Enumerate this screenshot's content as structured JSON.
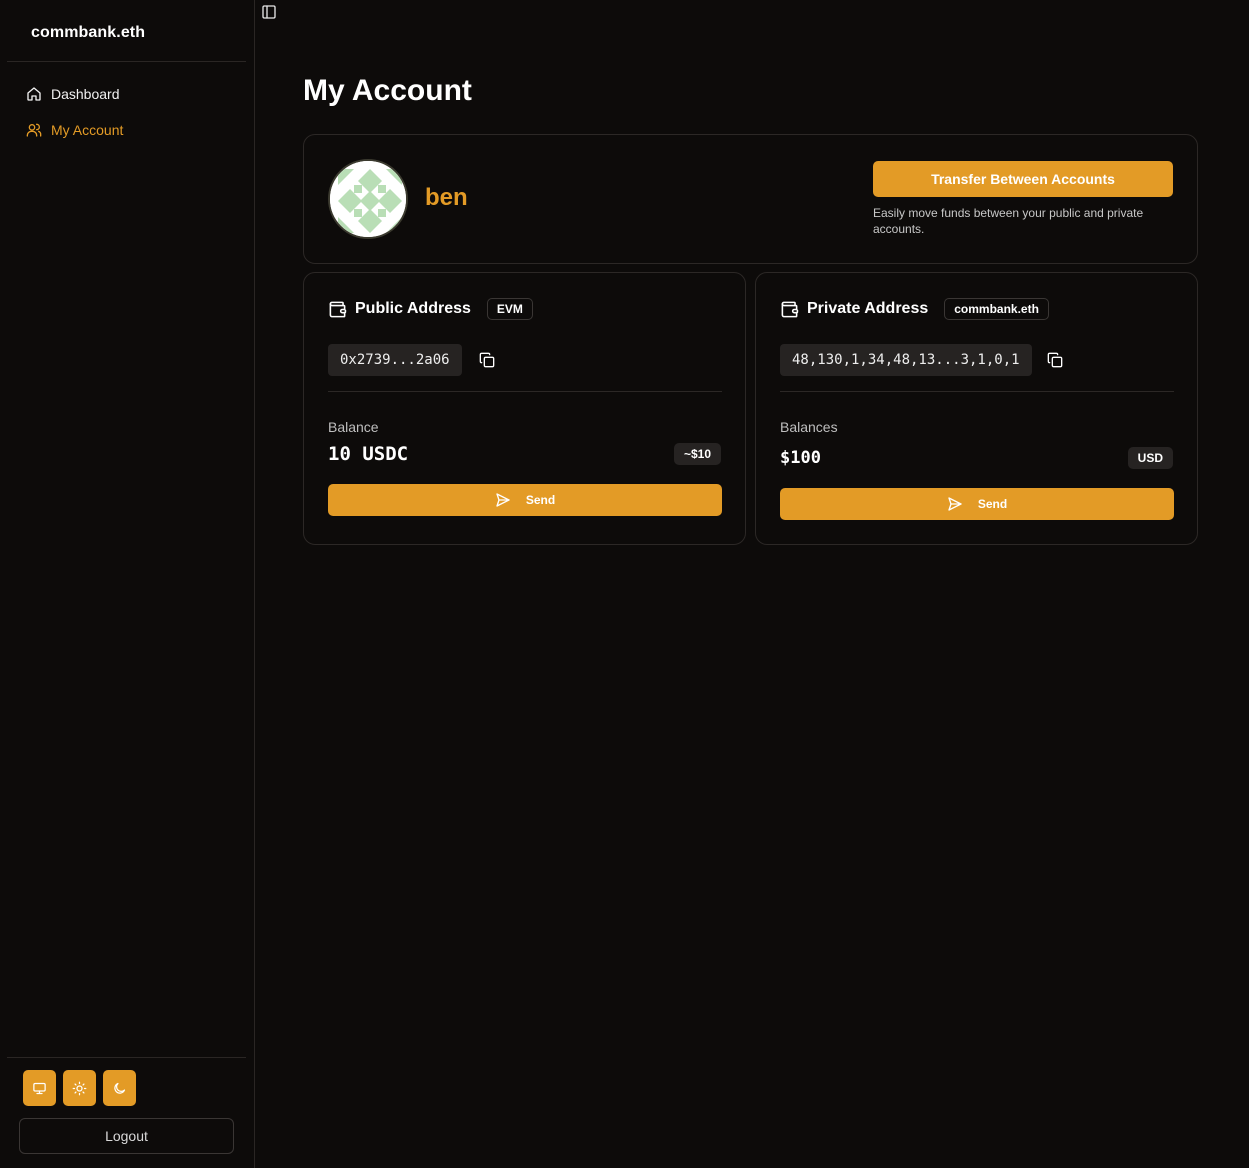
{
  "app": {
    "brand": "commbank.eth"
  },
  "sidebar": {
    "items": [
      {
        "label": "Dashboard",
        "icon": "home-icon"
      },
      {
        "label": "My Account",
        "icon": "users-icon"
      }
    ],
    "theme_buttons": [
      "monitor-icon",
      "sun-icon",
      "moon-icon"
    ],
    "logout_label": "Logout"
  },
  "page": {
    "title": "My Account"
  },
  "profile": {
    "username": "ben",
    "transfer_label": "Transfer Between Accounts",
    "transfer_desc": "Easily move funds between your public and private accounts."
  },
  "public_address": {
    "title": "Public Address",
    "tag": "EVM",
    "address": "0x2739...2a06",
    "balance_label": "Balance",
    "balance_value": "10 USDC",
    "balance_badge": "~$10",
    "send_label": "Send"
  },
  "private_address": {
    "title": "Private Address",
    "tag": "commbank.eth",
    "address": "48,130,1,34,48,13...3,1,0,1",
    "balance_label": "Balances",
    "balance_value": "$100",
    "balance_badge": "USD",
    "send_label": "Send"
  },
  "colors": {
    "accent": "#e39b26",
    "background": "#0d0b0a",
    "border": "#2c2826",
    "avatar_pattern": "#b9deb6"
  }
}
